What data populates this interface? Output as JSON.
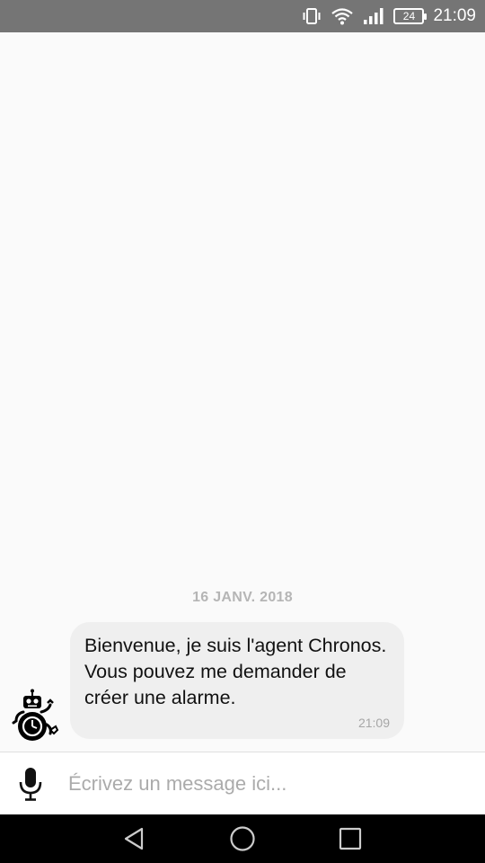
{
  "status_bar": {
    "battery_level": "24",
    "time": "21:09",
    "icons": [
      "vibrate-icon",
      "wifi-icon",
      "signal-icon",
      "battery-icon"
    ]
  },
  "conversation": {
    "date_separator": "16 JANV. 2018",
    "messages": [
      {
        "sender": "agent",
        "avatar": "robot-avatar-icon",
        "text": "Bienvenue, je suis l'agent Chronos. Vous pouvez me demander de créer une alarme.",
        "time": "21:09"
      }
    ]
  },
  "composer": {
    "mic_icon": "microphone-icon",
    "placeholder": "Écrivez un message ici...",
    "value": ""
  },
  "nav_bar": {
    "buttons": [
      "back-icon",
      "home-icon",
      "recents-icon"
    ]
  },
  "colors": {
    "status_bar_bg": "#757575",
    "background": "#fafafa",
    "bubble_bg": "#efefef",
    "nav_bar_bg": "#000000"
  }
}
